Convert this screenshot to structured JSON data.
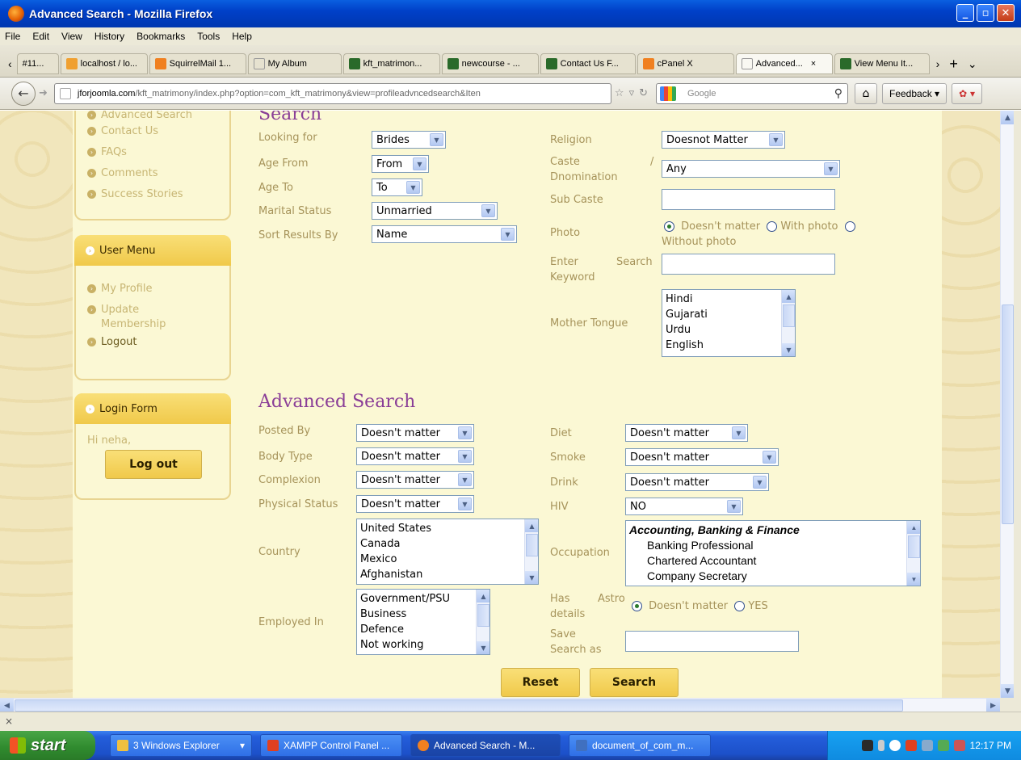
{
  "window": {
    "title": "Advanced Search - Mozilla Firefox"
  },
  "menubar": [
    "File",
    "Edit",
    "View",
    "History",
    "Bookmarks",
    "Tools",
    "Help"
  ],
  "tabs": [
    {
      "label": "#11...",
      "icon_color": "#ffffff"
    },
    {
      "label": "localhost / lo...",
      "icon_color": "#f0a030"
    },
    {
      "label": "SquirrelMail 1...",
      "icon_color": "#f08020"
    },
    {
      "label": "My Album",
      "icon_color": "#ffffff"
    },
    {
      "label": "kft_matrimon...",
      "icon_color": "#2a6a2a"
    },
    {
      "label": "newcourse - ...",
      "icon_color": "#2a6a2a"
    },
    {
      "label": "Contact Us F...",
      "icon_color": "#2a6a2a"
    },
    {
      "label": "cPanel X",
      "icon_color": "#f08020"
    },
    {
      "label": "Advanced...",
      "icon_color": "#ffffff",
      "active": true
    },
    {
      "label": "View Menu It...",
      "icon_color": "#2a6a2a"
    }
  ],
  "nav": {
    "url_domain": "jforjoomla.com",
    "url_path": "/kft_matrimony/index.php?option=com_kft_matrimony&view=profileadvncedsearch&Iten",
    "search_placeholder": "Google",
    "feedback_label": "Feedback"
  },
  "sidebar": {
    "main_menu_links": [
      "Advanced Search",
      "Contact Us",
      "FAQs",
      "Comments",
      "Success Stories"
    ],
    "user_menu": {
      "title": "User Menu",
      "links": [
        "My Profile",
        "Update Membership",
        "Logout"
      ]
    },
    "login_form": {
      "title": "Login Form",
      "greeting": "Hi neha,",
      "logout_label": "Log out"
    }
  },
  "search": {
    "heading": "Search",
    "looking_for": {
      "label": "Looking for",
      "value": "Brides"
    },
    "age_from": {
      "label": "Age From",
      "value": "From"
    },
    "age_to": {
      "label": "Age To",
      "value": "To"
    },
    "marital_status": {
      "label": "Marital Status",
      "value": "Unmarried"
    },
    "sort_by": {
      "label": "Sort Results By",
      "value": "Name"
    },
    "religion": {
      "label": "Religion",
      "value": "Doesnot Matter"
    },
    "caste": {
      "label_1": "Caste",
      "slash": "/",
      "label_2": "Dnomination",
      "value": "Any"
    },
    "sub_caste": {
      "label": "Sub Caste",
      "value": ""
    },
    "photo": {
      "label": "Photo",
      "opt1": "Doesn't matter",
      "opt2": "With photo",
      "opt3": "Without photo",
      "selected": "Doesn't matter"
    },
    "keyword": {
      "label_1": "Enter",
      "label_1b": "Search",
      "label_2": "Keyword",
      "value": ""
    },
    "mother_tongue": {
      "label": "Mother Tongue",
      "options": [
        "Hindi",
        "Gujarati",
        "Urdu",
        "English"
      ]
    }
  },
  "advanced": {
    "heading": "Advanced Search",
    "posted_by": {
      "label": "Posted By",
      "value": "Doesn't matter"
    },
    "body_type": {
      "label": "Body Type",
      "value": "Doesn't matter"
    },
    "complexion": {
      "label": "Complexion",
      "value": "Doesn't matter"
    },
    "physical_status": {
      "label": "Physical Status",
      "value": "Doesn't matter"
    },
    "country": {
      "label": "Country",
      "options": [
        "United States",
        "Canada",
        "Mexico",
        "Afghanistan"
      ]
    },
    "employed_in": {
      "label": "Employed In",
      "options": [
        "Government/PSU",
        "Business",
        "Defence",
        "Not working"
      ]
    },
    "diet": {
      "label": "Diet",
      "value": "Doesn't matter"
    },
    "smoke": {
      "label": "Smoke",
      "value": "Doesn't matter"
    },
    "drink": {
      "label": "Drink",
      "value": "Doesn't matter"
    },
    "hiv": {
      "label": "HIV",
      "value": "NO"
    },
    "occupation": {
      "label": "Occupation",
      "group": "Accounting, Banking & Finance",
      "options": [
        "Banking Professional",
        "Chartered Accountant",
        "Company Secretary"
      ]
    },
    "astro": {
      "label_1": "Has",
      "label_1b": "Astro",
      "label_2": "details",
      "opt1": "Doesn't matter",
      "opt2": "YES"
    },
    "save_search": {
      "label_1": "Save",
      "label_2": "Search as",
      "value": ""
    },
    "reset_label": "Reset",
    "search_label": "Search"
  },
  "statusbar": {
    "text": "×"
  },
  "taskbar": {
    "start_label": "start",
    "tasks": [
      {
        "label": "3 Windows Explorer",
        "icon_color": "#f0c040"
      },
      {
        "label": "XAMPP Control Panel ...",
        "icon_color": "#e04020"
      },
      {
        "label": "Advanced Search - M...",
        "icon_color": "#f08020",
        "active": true
      },
      {
        "label": "document_of_com_m...",
        "icon_color": "#4070c0"
      }
    ],
    "clock": "12:17 PM"
  }
}
